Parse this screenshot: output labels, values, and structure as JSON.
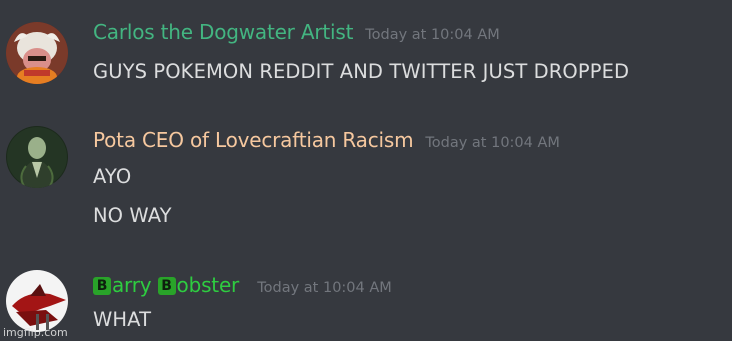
{
  "messages": [
    {
      "username": "Carlos the Dogwater Artist",
      "username_color": "#43b581",
      "timestamp": "Today at 10:04 AM",
      "lines": [
        "GUYS POKEMON REDDIT AND TWITTER JUST DROPPED"
      ]
    },
    {
      "username": "Pota CEO of Lovecraftian Racism",
      "username_color": "#f6c89f",
      "timestamp": "Today at 10:04 AM",
      "lines": [
        "AYO",
        "NO WAY"
      ]
    },
    {
      "username_parts": [
        {
          "badge": "B",
          "text": "arry "
        },
        {
          "badge": "B",
          "text": "obster"
        }
      ],
      "username_color": "#2ecc40",
      "timestamp": "Today at 10:04 AM",
      "lines": [
        "WHAT"
      ]
    }
  ],
  "watermark": "imgflip.com"
}
